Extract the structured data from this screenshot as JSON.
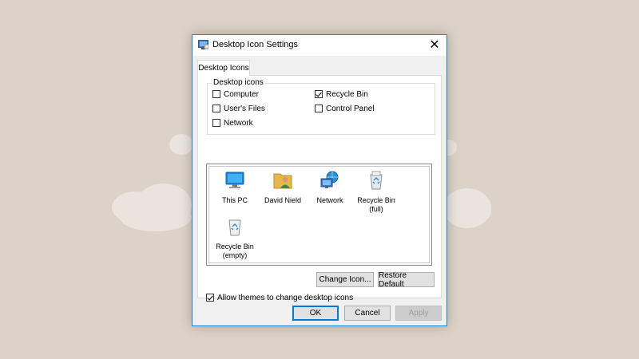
{
  "dialog": {
    "title": "Desktop Icon Settings",
    "close_glyph": "✕",
    "tab_label": "Desktop Icons"
  },
  "desktop_icons_group": {
    "legend": "Desktop icons",
    "items": [
      {
        "label": "Computer",
        "checked": false
      },
      {
        "label": "Recycle Bin",
        "checked": true
      },
      {
        "label": "User's Files",
        "checked": false
      },
      {
        "label": "Control Panel",
        "checked": false
      },
      {
        "label": "Network",
        "checked": false
      }
    ]
  },
  "icon_list": [
    {
      "label": "This PC",
      "icon": "monitor-icon"
    },
    {
      "label": "David Nield",
      "icon": "user-folder-icon"
    },
    {
      "label": "Network",
      "icon": "network-icon"
    },
    {
      "label": "Recycle Bin\n(full)",
      "line1": "Recycle Bin",
      "line2": "(full)",
      "icon": "recycle-bin-full-icon"
    },
    {
      "label": "Recycle Bin\n(empty)",
      "line1": "Recycle Bin",
      "line2": "(empty)",
      "icon": "recycle-bin-empty-icon"
    }
  ],
  "buttons": {
    "change_icon": "Change Icon...",
    "restore_default": "Restore Default",
    "ok": "OK",
    "cancel": "Cancel",
    "apply": "Apply"
  },
  "allow_themes": {
    "label": "Allow themes to change desktop icons",
    "checked": true
  },
  "colors": {
    "background": "#dcd2c8",
    "accent": "#0078d7",
    "dialog_face": "#f0f0f0"
  }
}
